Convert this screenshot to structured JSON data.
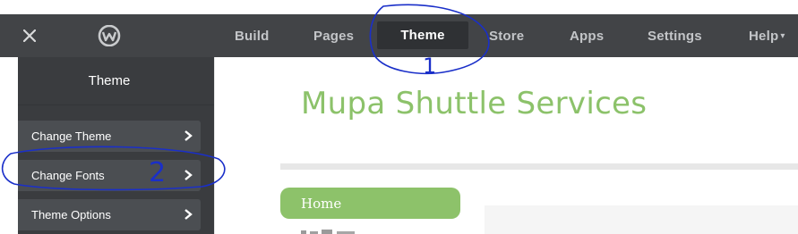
{
  "header": {
    "nav": [
      {
        "label": "Build"
      },
      {
        "label": "Pages"
      },
      {
        "label": "Theme"
      },
      {
        "label": "Store"
      },
      {
        "label": "Apps"
      },
      {
        "label": "Settings"
      },
      {
        "label": "Help"
      }
    ],
    "help_caret": "▾"
  },
  "sidebar": {
    "title": "Theme",
    "items": [
      {
        "label": "Change Theme"
      },
      {
        "label": "Change Fonts"
      },
      {
        "label": "Theme Options"
      }
    ]
  },
  "content": {
    "site_title": "Mupa Shuttle Services",
    "nav_home": "Home"
  },
  "annotations": {
    "marker_1": "1",
    "marker_2": "2",
    "color": "#1a2fc9"
  },
  "colors": {
    "header_bg": "#424447",
    "sidebar_bg": "#3a3c3f",
    "accent_green": "#8dc26a"
  }
}
